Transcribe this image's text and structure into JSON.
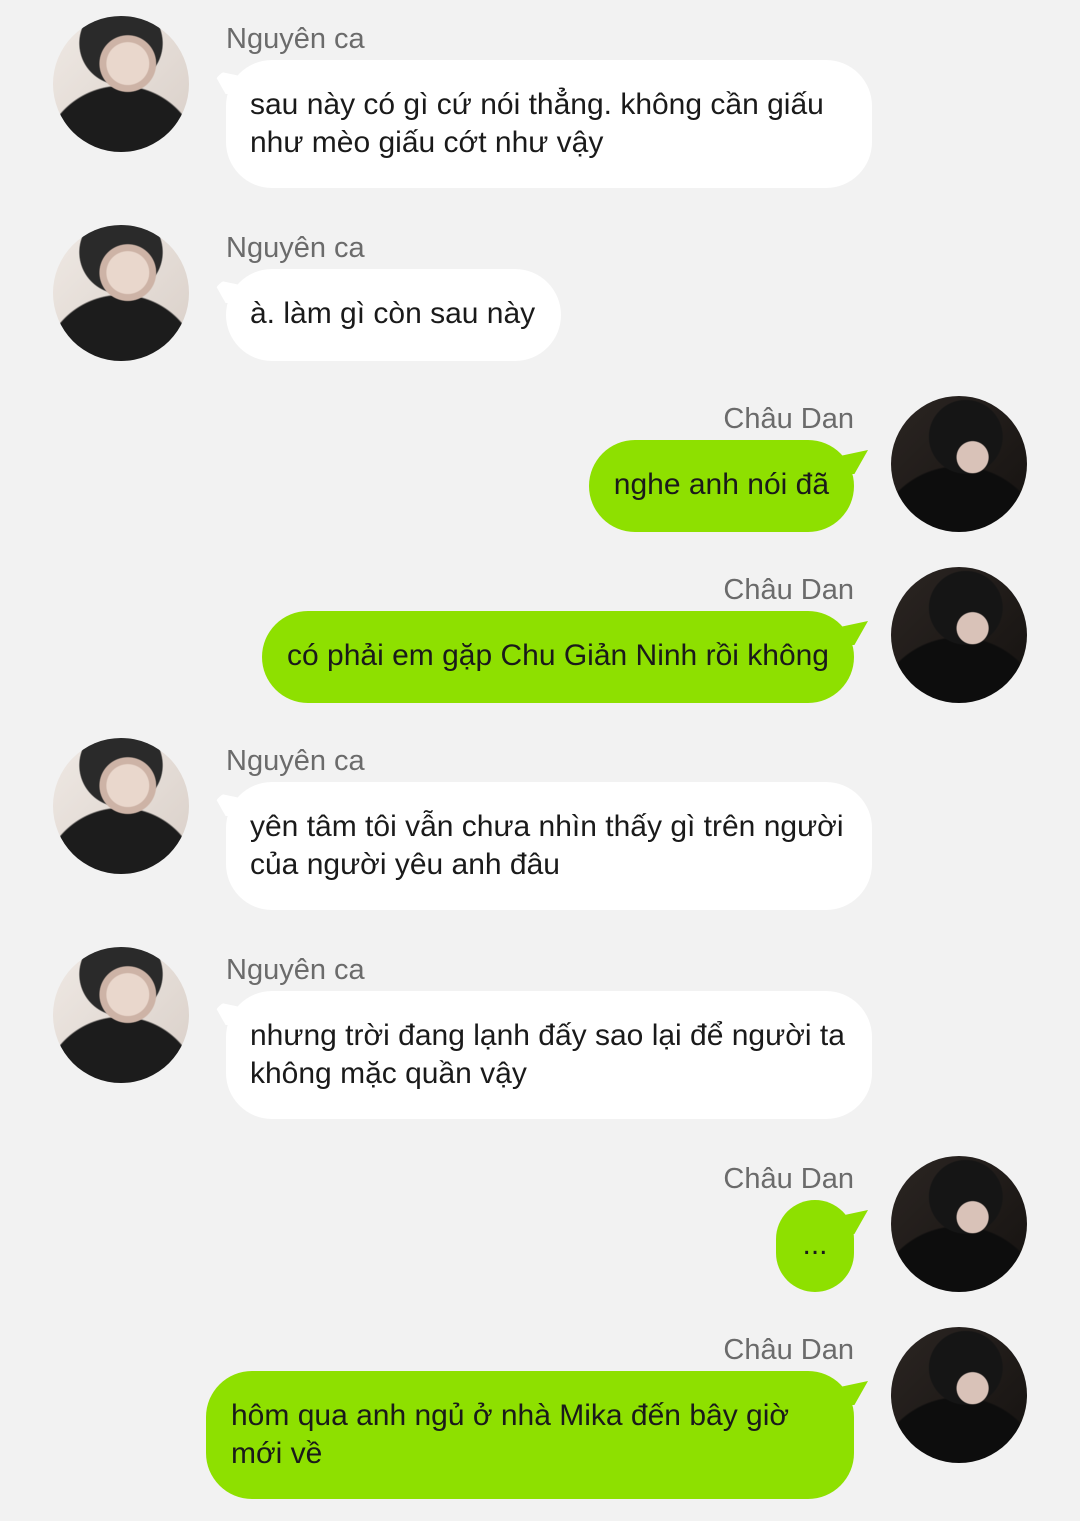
{
  "messages": [
    {
      "side": "left",
      "sender": "Nguyên ca",
      "text": "sau này có gì cứ nói thẳng. không cần giấu như mèo giấu cớt như vậy"
    },
    {
      "side": "left",
      "sender": "Nguyên ca",
      "text": "à. làm gì còn sau này"
    },
    {
      "side": "right",
      "sender": "Châu Dan",
      "text": "nghe anh nói đã"
    },
    {
      "side": "right",
      "sender": "Châu Dan",
      "text": "có phải em gặp Chu Giản Ninh rồi không"
    },
    {
      "side": "left",
      "sender": "Nguyên ca",
      "text": "yên tâm tôi vẫn chưa nhìn thấy gì trên người của người yêu anh đâu"
    },
    {
      "side": "left",
      "sender": "Nguyên ca",
      "text": "nhưng trời đang lạnh đấy sao lại để người ta không mặc quần vậy"
    },
    {
      "side": "right",
      "sender": "Châu Dan",
      "text": "..."
    },
    {
      "side": "right",
      "sender": "Châu Dan",
      "text": "hôm qua anh ngủ ở nhà Mika đến bây giờ mới về"
    }
  ],
  "colors": {
    "background": "#f2f2f2",
    "left_bubble": "#ffffff",
    "right_bubble": "#8ee000",
    "sender_name": "#6b6b6b"
  },
  "icons": {
    "left_avatar": "avatar-nguyen-ca",
    "right_avatar": "avatar-chau-dan"
  }
}
